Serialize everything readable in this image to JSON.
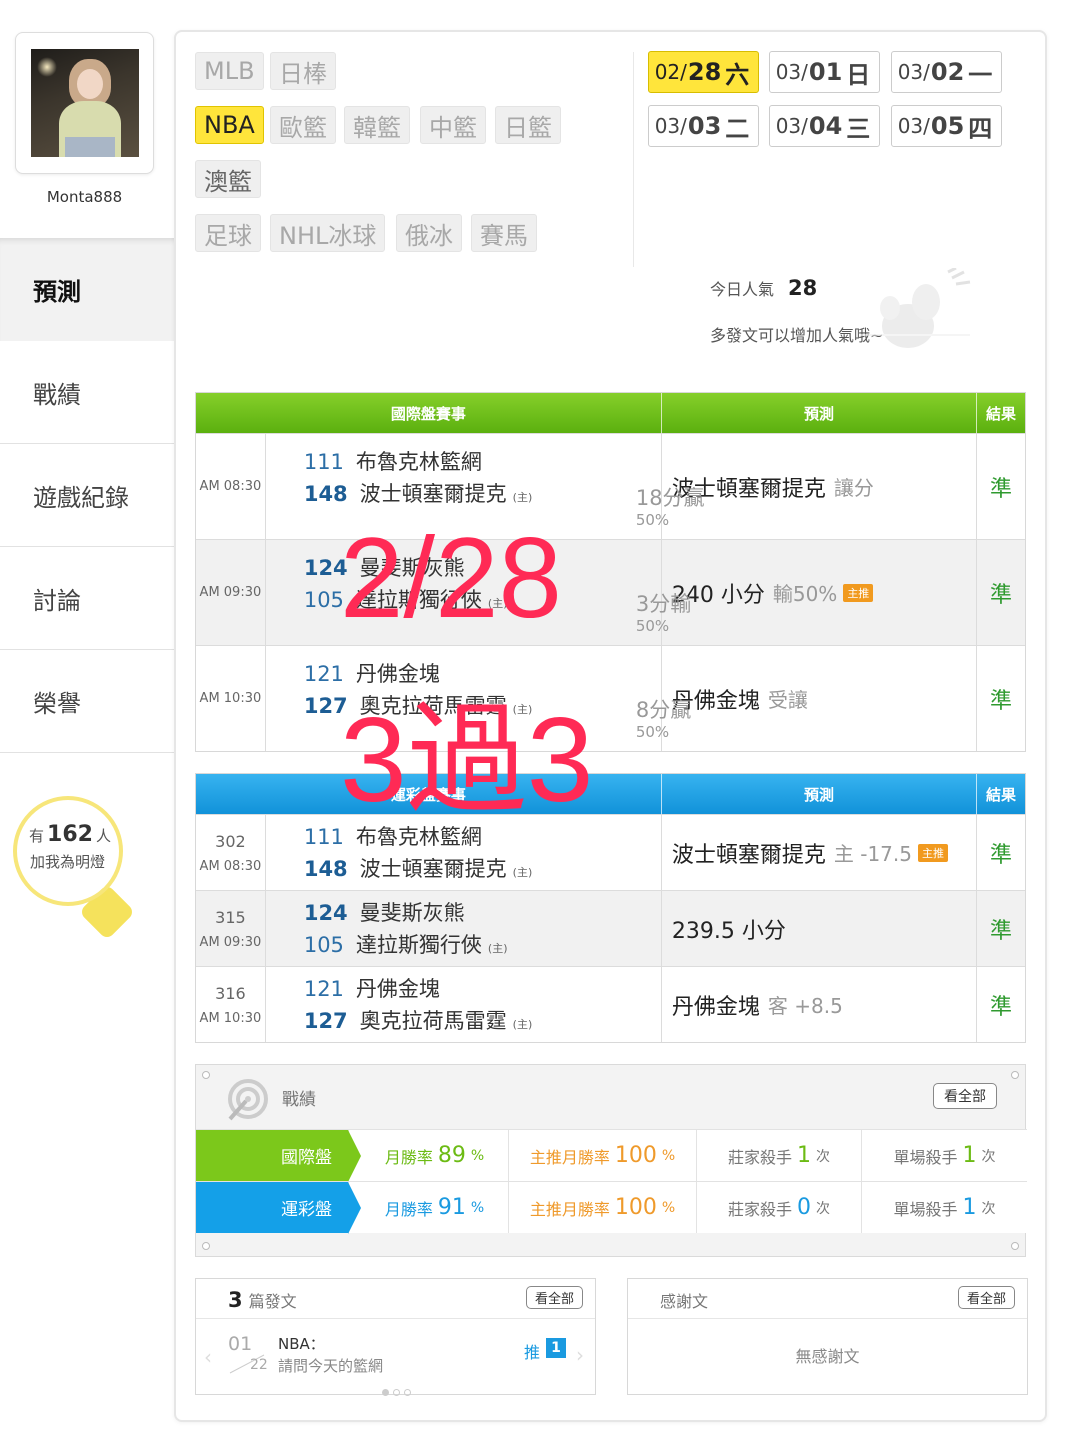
{
  "profile": {
    "username": "Monta888"
  },
  "nav": [
    "預測",
    "戰績",
    "遊戲紀錄",
    "討論",
    "榮譽"
  ],
  "fans": {
    "prefix": "有",
    "count": "162",
    "suffix": "人",
    "cta": "加我為明燈"
  },
  "sports": {
    "row1": [
      "MLB",
      "日棒"
    ],
    "row2": [
      "NBA",
      "歐籃",
      "韓籃",
      "中籃",
      "日籃"
    ],
    "row3": [
      "澳籃"
    ],
    "row4": [
      "足球",
      "NHL冰球",
      "俄冰",
      "賽馬"
    ],
    "active": "NBA"
  },
  "dates": [
    {
      "md": "02/",
      "d": "28",
      "w": "六",
      "active": true
    },
    {
      "md": "03/",
      "d": "01",
      "w": "日"
    },
    {
      "md": "03/",
      "d": "02",
      "w": "一"
    },
    {
      "md": "03/",
      "d": "03",
      "w": "二"
    },
    {
      "md": "03/",
      "d": "04",
      "w": "三"
    },
    {
      "md": "03/",
      "d": "05",
      "w": "四"
    }
  ],
  "popularity": {
    "label": "今日人氣",
    "value": "28",
    "note": "多發文可以增加人氣哦~"
  },
  "intl_table": {
    "headers": [
      "國際盤賽事",
      "預測",
      "結果"
    ],
    "rows": [
      {
        "time": "AM 08:30",
        "away_no": "111",
        "away": "布魯克林籃網",
        "home_no": "148",
        "home": "波士頓塞爾提克",
        "home_tag": "(主)",
        "hc_main": "18分贏",
        "hc_sub": "50%",
        "pick": "波士頓塞爾提克",
        "pick_extra": "讓分",
        "tag": "",
        "result": "準"
      },
      {
        "time": "AM 09:30",
        "away_no": "124",
        "away": "曼斐斯灰熊",
        "home_no": "105",
        "home": "達拉斯獨行俠",
        "home_tag": "(主)",
        "hc_main": "3分輸",
        "hc_sub": "50%",
        "pick": "240 小分",
        "pick_extra": "輸50%",
        "tag": "主推",
        "result": "準"
      },
      {
        "time": "AM 10:30",
        "away_no": "121",
        "away": "丹佛金塊",
        "home_no": "127",
        "home": "奧克拉荷馬雷霆",
        "home_tag": "(主)",
        "hc_main": "8分贏",
        "hc_sub": "50%",
        "pick": "丹佛金塊",
        "pick_extra": "受讓",
        "tag": "",
        "result": "準"
      }
    ]
  },
  "sport_table": {
    "headers": [
      "運彩盤賽事",
      "預測",
      "結果"
    ],
    "rows": [
      {
        "no": "302",
        "time": "AM 08:30",
        "away_no": "111",
        "away": "布魯克林籃網",
        "home_no": "148",
        "home": "波士頓塞爾提克",
        "home_tag": "(主)",
        "pick": "波士頓塞爾提克",
        "pick_extra": "主 -17.5",
        "tag": "主推",
        "result": "準"
      },
      {
        "no": "315",
        "time": "AM 09:30",
        "away_no": "124",
        "away": "曼斐斯灰熊",
        "home_no": "105",
        "home": "達拉斯獨行俠",
        "home_tag": "(主)",
        "pick": "239.5 小分",
        "pick_extra": "",
        "tag": "",
        "result": "準"
      },
      {
        "no": "316",
        "time": "AM 10:30",
        "away_no": "121",
        "away": "丹佛金塊",
        "home_no": "127",
        "home": "奧克拉荷馬雷霆",
        "home_tag": "(主)",
        "pick": "丹佛金塊",
        "pick_extra": "客 +8.5",
        "tag": "",
        "result": "準"
      }
    ]
  },
  "overlay": {
    "line1": "2/28",
    "line2": "3過3"
  },
  "record": {
    "title": "戰績",
    "view_all": "看全部",
    "rows": [
      {
        "label": "國際盤",
        "monthly_label": "月勝率",
        "monthly": "89",
        "top_label": "主推月勝率",
        "top": "100",
        "banker_label": "莊家殺手",
        "banker": "1",
        "single_label": "單場殺手",
        "single": "1"
      },
      {
        "label": "運彩盤",
        "monthly_label": "月勝率",
        "monthly": "91",
        "top_label": "主推月勝率",
        "top": "100",
        "banker_label": "莊家殺手",
        "banker": "0",
        "single_label": "單場殺手",
        "single": "1"
      }
    ],
    "pct": "%",
    "times": "次"
  },
  "posts": {
    "count": "3",
    "title": "篇發文",
    "view_all": "看全部",
    "item": {
      "month": "01",
      "day": "22",
      "category": "NBA：",
      "text": "請問今天的籃網",
      "push_label": "推",
      "push_count": "1"
    }
  },
  "thanks": {
    "title": "感謝文",
    "view_all": "看全部",
    "empty": "無感謝文"
  },
  "colors": {
    "green": "#7cc81b",
    "blue": "#14a0e8",
    "yellow": "#ffe53b",
    "overlay": "#ff2a55",
    "win": "#2f9a2f"
  }
}
